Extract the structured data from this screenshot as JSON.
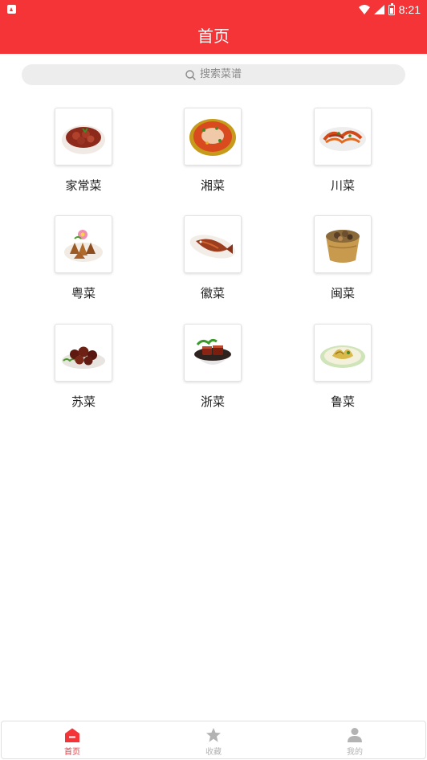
{
  "status": {
    "time": "8:21"
  },
  "header": {
    "title": "首页"
  },
  "search": {
    "placeholder": "搜索菜谱"
  },
  "cuisines": [
    {
      "label": "家常菜",
      "icon": "braised-pork-dish-image"
    },
    {
      "label": "湘菜",
      "icon": "spicy-fish-pot-image"
    },
    {
      "label": "川菜",
      "icon": "stir-fry-noodle-dish-image"
    },
    {
      "label": "粤菜",
      "icon": "fried-chicken-dish-image"
    },
    {
      "label": "徽菜",
      "icon": "braised-fish-dish-image"
    },
    {
      "label": "闽菜",
      "icon": "soup-jar-image"
    },
    {
      "label": "苏菜",
      "icon": "sweet-sour-ribs-image"
    },
    {
      "label": "浙菜",
      "icon": "dongpo-pork-image"
    },
    {
      "label": "鲁菜",
      "icon": "vegetable-plate-image"
    }
  ],
  "tabs": [
    {
      "label": "首页",
      "icon": "home-icon",
      "active": true
    },
    {
      "label": "收藏",
      "icon": "star-icon",
      "active": false
    },
    {
      "label": "我的",
      "icon": "user-icon",
      "active": false
    }
  ],
  "colors": {
    "brand": "#f53438",
    "inactive": "#b3b3b3",
    "search_bg": "#ededed"
  }
}
